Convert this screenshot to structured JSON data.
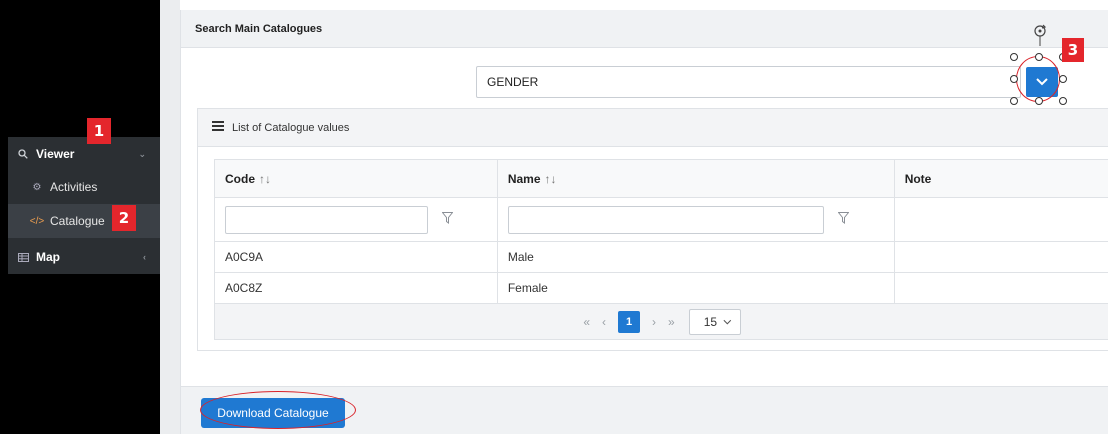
{
  "sidebar": {
    "items": [
      {
        "label": "Viewer",
        "icon": "search-icon"
      },
      {
        "label": "Activities",
        "icon": "gears-icon"
      },
      {
        "label": "Catalogue",
        "icon": "code-icon"
      },
      {
        "label": "Map",
        "icon": "table-icon"
      }
    ]
  },
  "annotations": {
    "badge1": "1",
    "badge2": "2",
    "badge3": "3"
  },
  "panel": {
    "title": "Search Main Catalogues",
    "catalogue_select": {
      "value": "GENDER"
    }
  },
  "list": {
    "title": "List of Catalogue values",
    "columns": [
      {
        "label": "Code",
        "sort": "↑↓"
      },
      {
        "label": "Name",
        "sort": "↑↓"
      },
      {
        "label": "Note"
      }
    ],
    "rows": [
      {
        "code": "A0C9A",
        "name": "Male",
        "note": ""
      },
      {
        "code": "A0C8Z",
        "name": "Female",
        "note": ""
      }
    ],
    "pager": {
      "first": "«",
      "prev": "‹",
      "page": "1",
      "next": "›",
      "last": "»",
      "page_size": "15"
    }
  },
  "footer": {
    "download_label": "Download Catalogue"
  },
  "colors": {
    "primary": "#1f79d2",
    "sidebar_bg": "#2b2f33",
    "annotation_red": "#e4262c"
  }
}
